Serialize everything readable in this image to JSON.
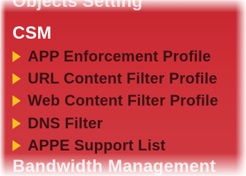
{
  "sections": {
    "previous_heading": "Objects Setting",
    "current_heading": "CSM",
    "next_heading": "Bandwidth Management"
  },
  "csm_menu": {
    "items": [
      {
        "label": "APP Enforcement Profile",
        "icon": "triangle-right-arrow"
      },
      {
        "label": "URL Content Filter Profile",
        "icon": "triangle-right-arrow"
      },
      {
        "label": "Web Content Filter Profile",
        "icon": "triangle-right-arrow"
      },
      {
        "label": "DNS Filter",
        "icon": "triangle-right-arrow"
      },
      {
        "label": "APPE Support List",
        "icon": "triangle-right-arrow"
      }
    ]
  },
  "colors": {
    "panel_background": "#cf3038",
    "heading_text": "#ffffff",
    "item_text": "#3a1214",
    "arrow": "#f6c21a"
  }
}
